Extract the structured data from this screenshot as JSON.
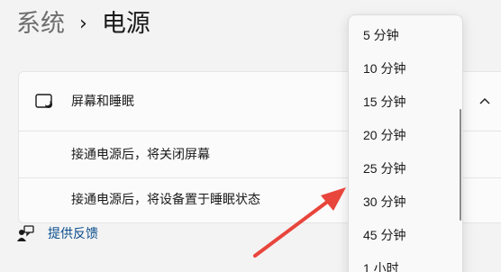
{
  "breadcrumb": {
    "parent": "系统",
    "separator": "›",
    "current": "电源"
  },
  "screen_sleep": {
    "header_label": "屏幕和睡眠",
    "rows": [
      {
        "label": "接通电源后，将关闭屏幕"
      },
      {
        "label": "接通电源后，将设备置于睡眠状态"
      }
    ]
  },
  "feedback": {
    "label": "提供反馈"
  },
  "dropdown": {
    "options": [
      "5 分钟",
      "10 分钟",
      "15 分钟",
      "20 分钟",
      "25 分钟",
      "30 分钟",
      "45 分钟",
      "1 小时"
    ]
  },
  "colors": {
    "annotation_arrow": "#e8453c",
    "link": "#0a4d8c"
  },
  "icons": [
    "screen-sleep-icon",
    "chevron-up-icon",
    "feedback-icon"
  ]
}
